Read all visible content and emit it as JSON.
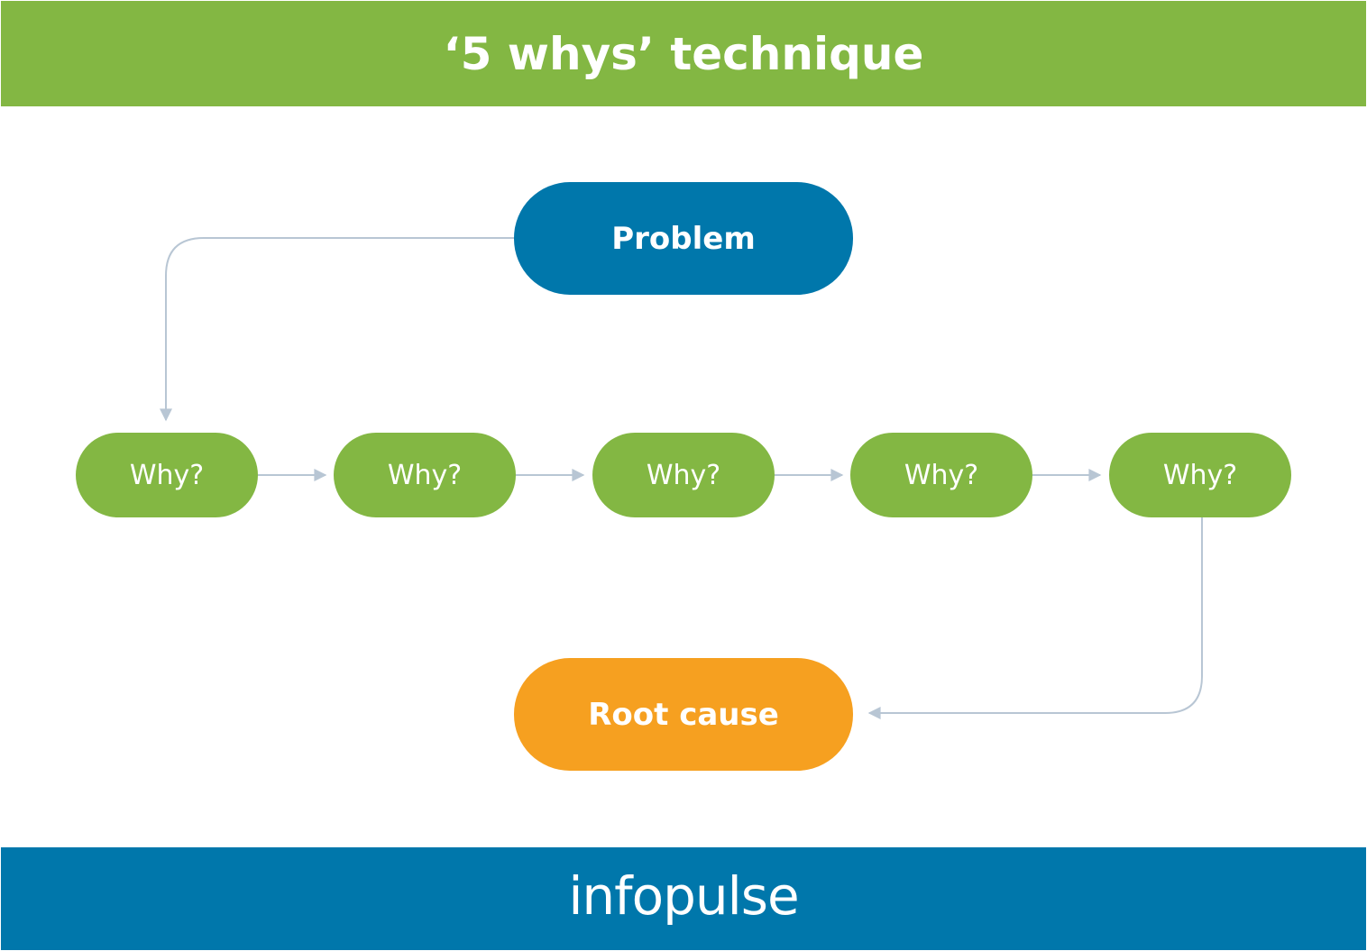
{
  "header": {
    "title": "‘5 whys’ technique"
  },
  "diagram": {
    "problem": {
      "label": "Problem"
    },
    "whys": [
      {
        "label": "Why?"
      },
      {
        "label": "Why?"
      },
      {
        "label": "Why?"
      },
      {
        "label": "Why?"
      },
      {
        "label": "Why?"
      }
    ],
    "root_cause": {
      "label": "Root cause"
    }
  },
  "footer": {
    "brand": "infopulse"
  },
  "colors": {
    "green": "#83b743",
    "blue": "#0077ab",
    "orange": "#f6a020",
    "connector": "#b8c6d4"
  }
}
